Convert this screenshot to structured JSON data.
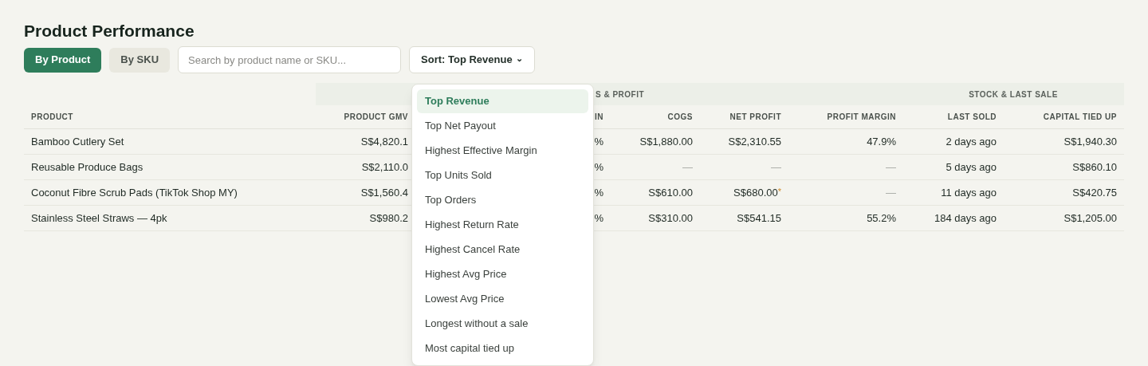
{
  "title": "Product Performance",
  "view_tabs": [
    {
      "label": "By Product",
      "selected": true
    },
    {
      "label": "By SKU",
      "selected": false
    }
  ],
  "search": {
    "placeholder": "Search by product name or SKU..."
  },
  "sort_button": {
    "label": "Sort: Top Revenue",
    "caret": "⌄"
  },
  "table": {
    "groups": [
      {
        "label": "S & PROFIT"
      },
      {
        "label": "STOCK & LAST SALE"
      }
    ],
    "columns": [
      "PRODUCT",
      "PRODUCT GMV",
      "IN",
      "COGS",
      "NET PROFIT",
      "PROFIT MARGIN",
      "LAST SOLD",
      "CAPITAL TIED UP"
    ],
    "rows": [
      [
        {
          "text": "Bamboo Cutlery Set"
        },
        {
          "text": "S$4,820.1"
        },
        {
          "text": "%"
        },
        {
          "text": "S$1,880.00"
        },
        {
          "text": "S$2,310.55"
        },
        {
          "text": "47.9%"
        },
        {
          "text": "2 days ago"
        },
        {
          "text": "S$1,940.30"
        }
      ],
      [
        {
          "text": "Reusable Produce Bags"
        },
        {
          "text": "S$2,110.0"
        },
        {
          "text": "%"
        },
        {
          "text": "—",
          "muted": true
        },
        {
          "text": "—",
          "muted": true
        },
        {
          "text": "—",
          "muted": true
        },
        {
          "text": "5 days ago"
        },
        {
          "text": "S$860.10"
        }
      ],
      [
        {
          "text": "Coconut Fibre Scrub Pads (TikTok Shop MY)"
        },
        {
          "text": "S$1,560.4"
        },
        {
          "text": "%"
        },
        {
          "text": "S$610.00"
        },
        {
          "text": "S$680.00",
          "note": "*"
        },
        {
          "text": "—",
          "muted": true
        },
        {
          "text": "11 days ago"
        },
        {
          "text": "S$420.75"
        }
      ],
      [
        {
          "text": "Stainless Steel Straws — 4pk"
        },
        {
          "text": "S$980.2"
        },
        {
          "text": "%"
        },
        {
          "text": "S$310.00"
        },
        {
          "text": "S$541.15"
        },
        {
          "text": "55.2%"
        },
        {
          "text": "184 days ago"
        },
        {
          "text": "S$1,205.00"
        }
      ]
    ]
  },
  "sort_menu": {
    "items": [
      {
        "label": "Top Revenue",
        "selected": true
      },
      {
        "label": "Top Net Payout",
        "selected": false
      },
      {
        "label": "Highest Effective Margin",
        "selected": false
      },
      {
        "label": "Top Units Sold",
        "selected": false
      },
      {
        "label": "Top Orders",
        "selected": false
      },
      {
        "label": "Highest Return Rate",
        "selected": false
      },
      {
        "label": "Highest Cancel Rate",
        "selected": false
      },
      {
        "label": "Highest Avg Price",
        "selected": false
      },
      {
        "label": "Lowest Avg Price",
        "selected": false
      },
      {
        "label": "Longest without a sale",
        "selected": false
      },
      {
        "label": "Most capital tied up",
        "selected": false
      }
    ]
  }
}
